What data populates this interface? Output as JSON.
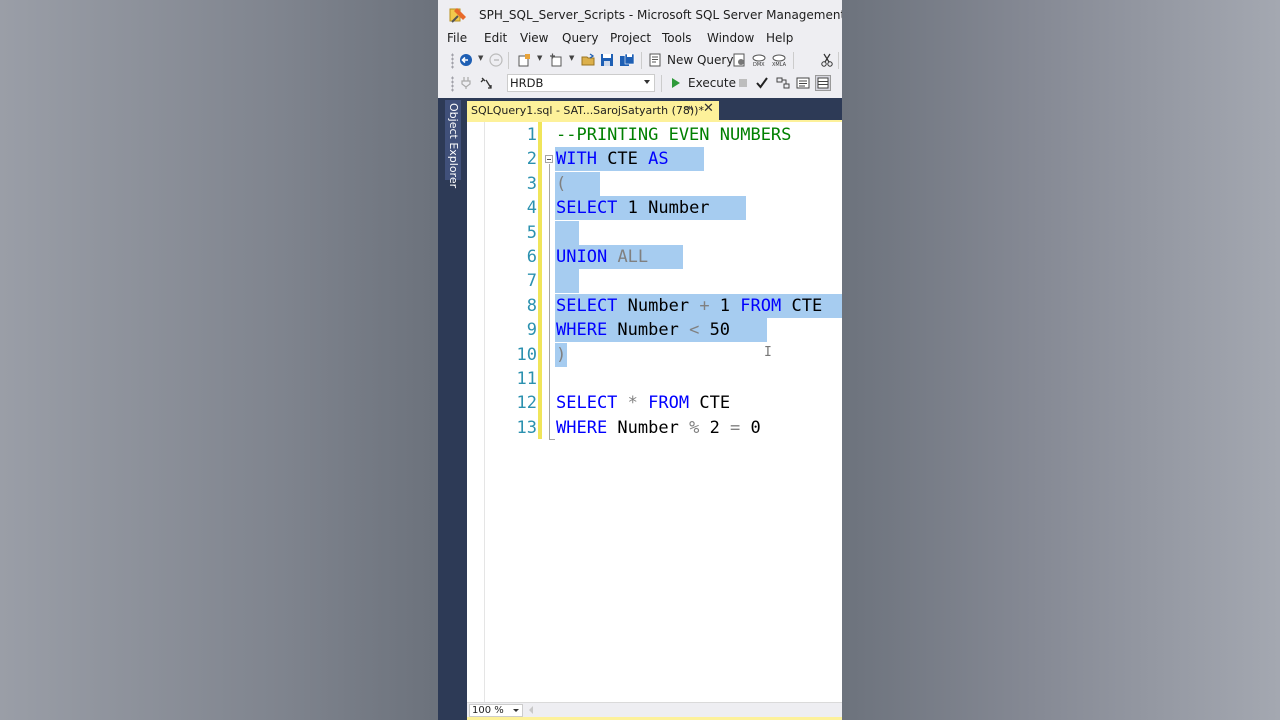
{
  "window": {
    "title": "SPH_SQL_Server_Scripts - Microsoft SQL Server Management Studio"
  },
  "menu": [
    "File",
    "Edit",
    "View",
    "Query",
    "Project",
    "Tools",
    "Window",
    "Help"
  ],
  "toolbar": {
    "new_query_label": "New Query",
    "database": "HRDB",
    "execute_label": "Execute",
    "icons": [
      "back-icon",
      "forward-icon",
      "new-project-icon",
      "add-item-icon",
      "open-file-icon",
      "save-icon",
      "save-all-icon",
      "new-query-icon",
      "mdx-query-icon",
      "dmx-query-icon",
      "xmla-query-icon",
      "cut-icon",
      "connect-icon",
      "change-connection-icon",
      "execute-icon",
      "stop-icon",
      "parse-icon",
      "estimated-plan-icon",
      "results-to-text-icon",
      "results-to-grid-icon"
    ]
  },
  "sidebar": {
    "object_explorer_label": "Object Explorer"
  },
  "tab": {
    "title": "SQLQuery1.sql - SAT...SarojSatyarth (78))*"
  },
  "editor": {
    "colors": {
      "keyword": "#0000ff",
      "comment": "#008000",
      "operator": "#808080",
      "line_number": "#2b91af",
      "selection": "#a6ccf0"
    },
    "lines": [
      {
        "n": "1",
        "tokens": [
          [
            "--PRINTING EVEN NUMBERS",
            "cmt"
          ]
        ]
      },
      {
        "n": "2",
        "tokens": [
          [
            "WITH",
            "kw"
          ],
          [
            " CTE ",
            ""
          ],
          [
            "AS",
            "kw"
          ]
        ]
      },
      {
        "n": "3",
        "tokens": [
          [
            "(",
            "op"
          ]
        ]
      },
      {
        "n": "4",
        "tokens": [
          [
            "SELECT",
            "kw"
          ],
          [
            " 1 Number",
            ""
          ]
        ]
      },
      {
        "n": "5",
        "tokens": []
      },
      {
        "n": "6",
        "tokens": [
          [
            "UNION",
            "kw"
          ],
          [
            " ",
            ""
          ],
          [
            "ALL",
            "grey"
          ]
        ]
      },
      {
        "n": "7",
        "tokens": []
      },
      {
        "n": "8",
        "tokens": [
          [
            "SELECT",
            "kw"
          ],
          [
            " Number ",
            ""
          ],
          [
            "+",
            "op"
          ],
          [
            " 1 ",
            ""
          ],
          [
            "FROM",
            "kw"
          ],
          [
            " CTE",
            ""
          ]
        ]
      },
      {
        "n": "9",
        "tokens": [
          [
            "WHERE",
            "kw"
          ],
          [
            " Number ",
            ""
          ],
          [
            "<",
            "op"
          ],
          [
            " 50",
            ""
          ]
        ]
      },
      {
        "n": "10",
        "tokens": [
          [
            ")",
            "op"
          ]
        ]
      },
      {
        "n": "11",
        "tokens": []
      },
      {
        "n": "12",
        "tokens": [
          [
            "SELECT",
            "kw"
          ],
          [
            " ",
            ""
          ],
          [
            "*",
            "op"
          ],
          [
            " ",
            ""
          ],
          [
            "FROM",
            "kw"
          ],
          [
            " CTE",
            ""
          ]
        ]
      },
      {
        "n": "13",
        "tokens": [
          [
            "WHERE",
            "kw"
          ],
          [
            " Number ",
            ""
          ],
          [
            "%",
            "op"
          ],
          [
            " 2 ",
            ""
          ],
          [
            "=",
            "op"
          ],
          [
            " 0",
            ""
          ]
        ]
      }
    ]
  },
  "zoom": {
    "value": "100 %"
  }
}
